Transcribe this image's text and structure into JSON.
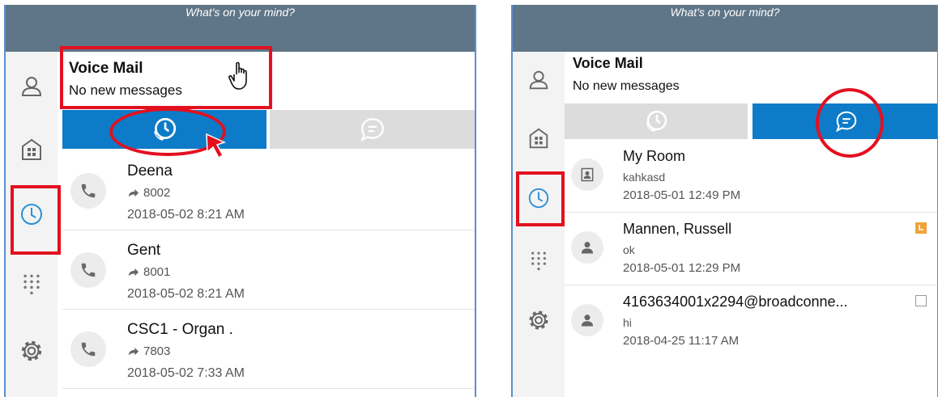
{
  "status_prompt": "What's on your mind?",
  "voicemail": {
    "title": "Voice Mail",
    "subtitle": "No new messages"
  },
  "tabs": [
    {
      "name": "call-history-tab",
      "icon": "phone-clock-icon"
    },
    {
      "name": "chat-history-tab",
      "icon": "chat-bubble-icon"
    }
  ],
  "sidebar": [
    {
      "name": "contacts",
      "icon": "person-icon"
    },
    {
      "name": "rooms",
      "icon": "building-icon"
    },
    {
      "name": "history",
      "icon": "clock-icon",
      "selected": true
    },
    {
      "name": "dialpad",
      "icon": "dialpad-icon"
    },
    {
      "name": "settings",
      "icon": "gear-icon"
    }
  ],
  "calls": [
    {
      "name": "Deena",
      "number": "8002",
      "time": "2018-05-02 8:21 AM"
    },
    {
      "name": "Gent",
      "number": "8001",
      "time": "2018-05-02 8:21 AM"
    },
    {
      "name": "CSC1 - Organ .",
      "number": "7803",
      "time": "2018-05-02 7:33 AM"
    }
  ],
  "chats": [
    {
      "name": "My Room",
      "message": "kahkasd",
      "time": "2018-05-01 12:49 PM",
      "type": "room"
    },
    {
      "name": "Mannen, Russell",
      "message": "ok",
      "time": "2018-05-01 12:29 PM",
      "type": "person",
      "status_color": "#f0a33a"
    },
    {
      "name": "4163634001x2294@broadconne...",
      "message": "hi",
      "time": "2018-04-25 11:17 AM",
      "type": "person",
      "status_color": "#ffffff"
    }
  ],
  "colors": {
    "accent": "#0d7bc8",
    "header": "#5f7588",
    "highlight": "#e3101f",
    "away": "#f0a33a"
  }
}
